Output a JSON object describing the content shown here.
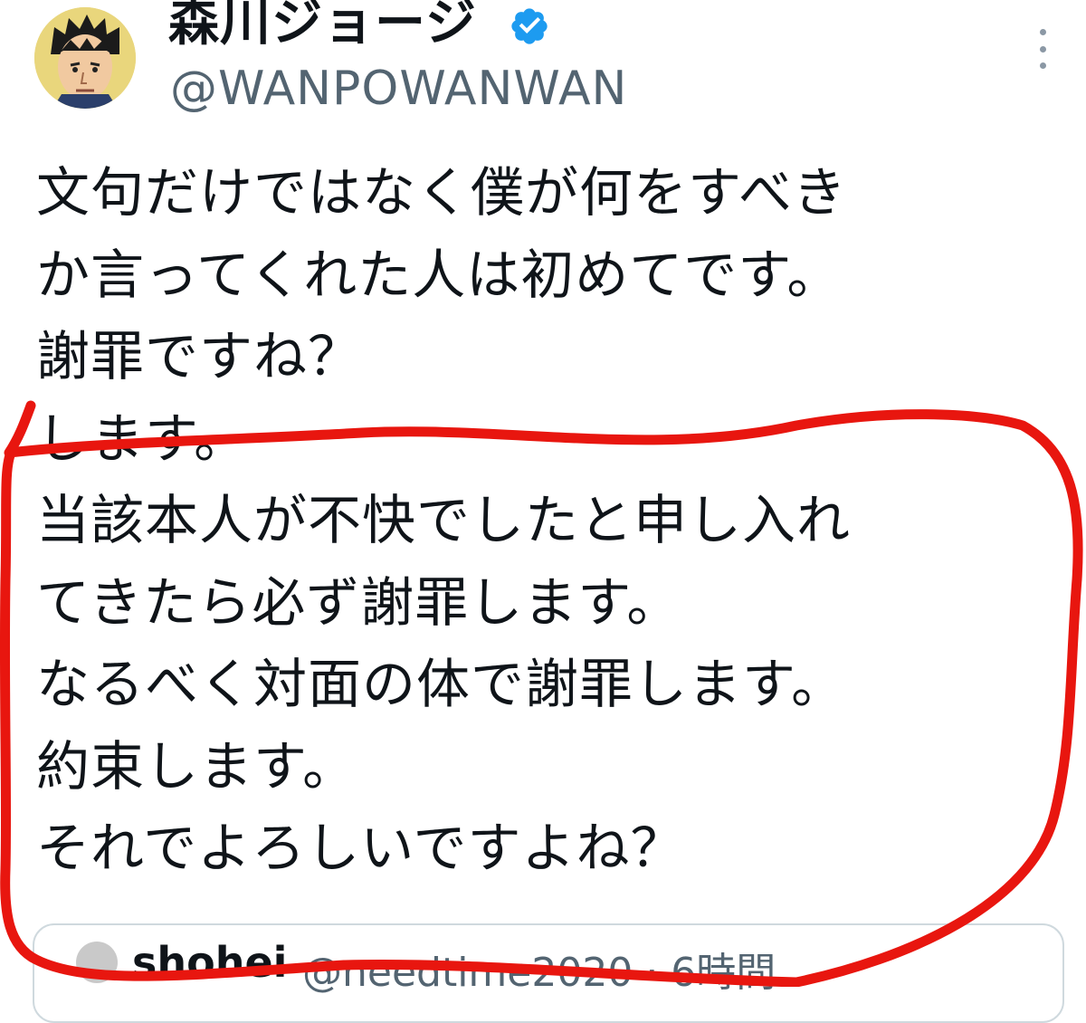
{
  "author": {
    "display_name": "森川ジョージ",
    "handle": "@WANPOWANWAN",
    "verified": true,
    "avatar_icon": "manga-character-avatar"
  },
  "more_menu_icon": "more-vertical-icon",
  "tweet": {
    "lines": [
      "文句だけではなく僕が何をすべき",
      "か言ってくれた人は初めてです。",
      "謝罪ですね？",
      "します。",
      "当該本人が不快でしたと申し入れ",
      "てきたら必ず謝罪します。",
      "なるべく対面の体で謝罪します。",
      "約束します。",
      "それでよろしいですよね？"
    ]
  },
  "quoted_tweet": {
    "name": "shohei",
    "meta": "@needtime2020 · 6時間"
  },
  "colors": {
    "text": "#0f1419",
    "secondary": "#536471",
    "verified_blue": "#1d9bf0",
    "annotation_red": "#e8160f"
  }
}
